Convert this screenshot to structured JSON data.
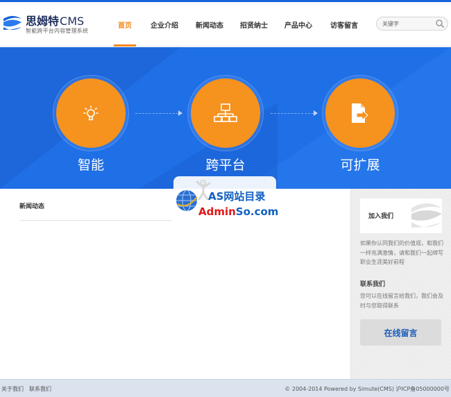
{
  "header": {
    "logo_title": "思姆特",
    "logo_cms": "CMS",
    "logo_subtitle": "智能跨平台内容管理系统",
    "nav": [
      {
        "label": "首页",
        "active": true
      },
      {
        "label": "企业介绍",
        "active": false
      },
      {
        "label": "新闻动态",
        "active": false
      },
      {
        "label": "招贤纳士",
        "active": false
      },
      {
        "label": "产品中心",
        "active": false
      },
      {
        "label": "访客留言",
        "active": false
      }
    ],
    "search_placeholder": "关键字"
  },
  "banner": {
    "features": [
      {
        "label": "智能",
        "icon": "lightbulb-icon"
      },
      {
        "label": "跨平台",
        "icon": "network-icon"
      },
      {
        "label": "可扩展",
        "icon": "extension-icon"
      }
    ],
    "colors": {
      "background": "#1f6fe6",
      "circle": "#f6921e"
    }
  },
  "main": {
    "news_title": "新闻动态"
  },
  "watermark": {
    "title": "AS网站目录",
    "domain_red": "Admin",
    "domain_blue": "So.com"
  },
  "sidebar": {
    "join_title": "加入我们",
    "join_text": "如果你认同我们的价值观，和我们一样充满激情，请和我们一起缔写职业生涯美好前程",
    "contact_title": "联系我们",
    "contact_text": "您可以在线留言给我们，我们会及时与您取得联系",
    "message_button": "在线留言"
  },
  "footer": {
    "links": [
      "关于我们",
      "联系我们"
    ],
    "copyright": "© 2004-2014 Powered by Simute(CMS) 沪ICP备05000000号"
  }
}
